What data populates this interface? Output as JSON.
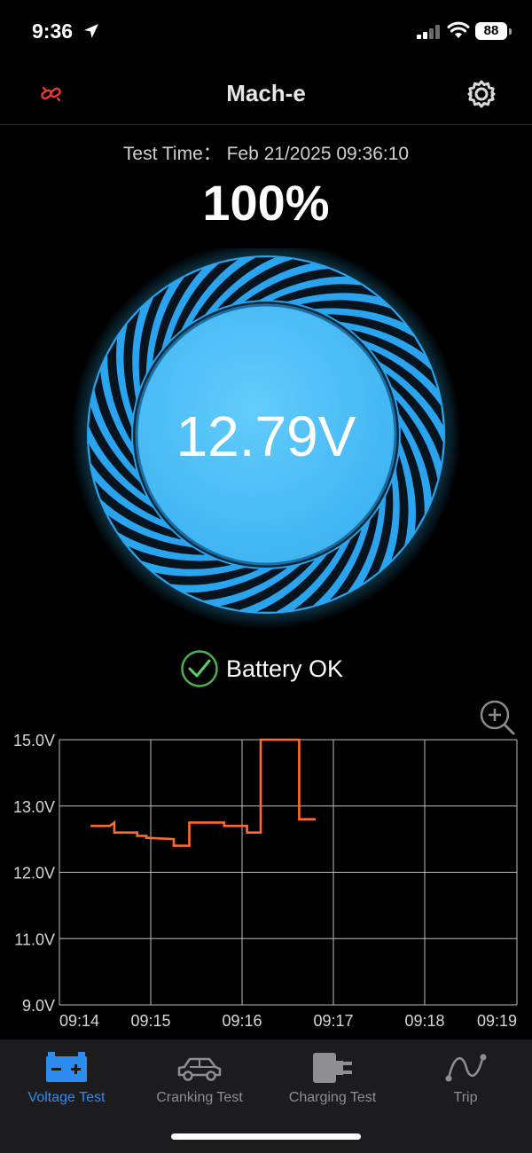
{
  "status_bar": {
    "time": "9:36",
    "battery": "88"
  },
  "header": {
    "title": "Mach-e"
  },
  "test": {
    "time_label": "Test Time：",
    "time_value": "Feb 21/2025 09:36:10",
    "percent": "100%",
    "voltage": "12.79V",
    "status": "Battery OK"
  },
  "colors": {
    "accent": "#4fc3f7",
    "line": "#ff6a2b",
    "active_tab": "#2d8cf0"
  },
  "chart_data": {
    "type": "line",
    "y_tick_labels": [
      "15.0V",
      "13.0V",
      "12.0V",
      "11.0V",
      "9.0V"
    ],
    "x_tick_labels": [
      "09:14",
      "09:15",
      "09:16",
      "09:17",
      "09:18",
      "09:19"
    ],
    "grid": true,
    "series": [
      {
        "values_y": [
          12.7,
          12.7,
          12.75,
          12.6,
          12.6,
          12.55,
          12.55,
          12.52,
          12.5,
          12.4,
          12.4,
          12.75,
          12.75,
          12.7,
          12.7,
          12.6,
          12.6,
          15.0,
          15.0,
          12.8,
          12.8
        ],
        "values_x": [
          0.34,
          0.55,
          0.6,
          0.6,
          0.85,
          0.85,
          0.95,
          0.95,
          1.25,
          1.25,
          1.42,
          1.42,
          1.8,
          1.8,
          2.05,
          2.05,
          2.2,
          2.2,
          2.62,
          2.62,
          2.8
        ]
      }
    ]
  },
  "tabs": [
    {
      "label": "Voltage Test",
      "icon": "battery-icon",
      "active": true
    },
    {
      "label": "Cranking Test",
      "icon": "car-icon",
      "active": false
    },
    {
      "label": "Charging Test",
      "icon": "plug-icon",
      "active": false
    },
    {
      "label": "Trip",
      "icon": "route-icon",
      "active": false
    }
  ]
}
